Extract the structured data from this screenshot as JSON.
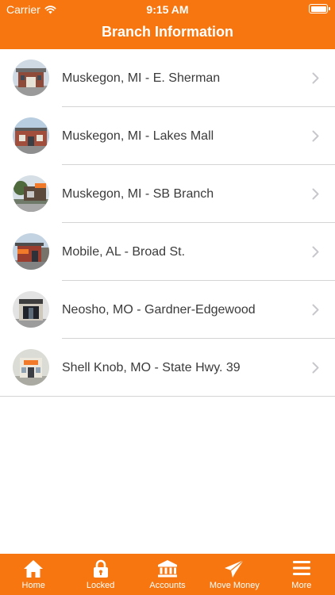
{
  "status_bar": {
    "carrier": "Carrier",
    "time": "9:15 AM",
    "wifi_icon": "wifi-icon",
    "battery_icon": "battery-icon"
  },
  "nav": {
    "title": "Branch Information"
  },
  "branches": [
    {
      "name": "Muskegon, MI - E. Sherman",
      "thumbnail": "branch-photo"
    },
    {
      "name": "Muskegon, MI - Lakes Mall",
      "thumbnail": "branch-photo"
    },
    {
      "name": "Muskegon, MI - SB Branch",
      "thumbnail": "branch-photo"
    },
    {
      "name": "Mobile, AL - Broad St.",
      "thumbnail": "branch-photo"
    },
    {
      "name": "Neosho, MO - Gardner-Edgewood",
      "thumbnail": "branch-photo"
    },
    {
      "name": "Shell Knob, MO - State Hwy. 39",
      "thumbnail": "branch-photo"
    }
  ],
  "tabs": [
    {
      "label": "Home",
      "icon": "home-icon"
    },
    {
      "label": "Locked",
      "icon": "lock-icon"
    },
    {
      "label": "Accounts",
      "icon": "bank-icon"
    },
    {
      "label": "Move Money",
      "icon": "paper-plane-icon"
    },
    {
      "label": "More",
      "icon": "hamburger-menu-icon"
    }
  ],
  "colors": {
    "brand_orange": "#f7760f",
    "separator": "#d4d4d4",
    "text": "#3b3b3b",
    "chevron": "#c7c7cc"
  }
}
